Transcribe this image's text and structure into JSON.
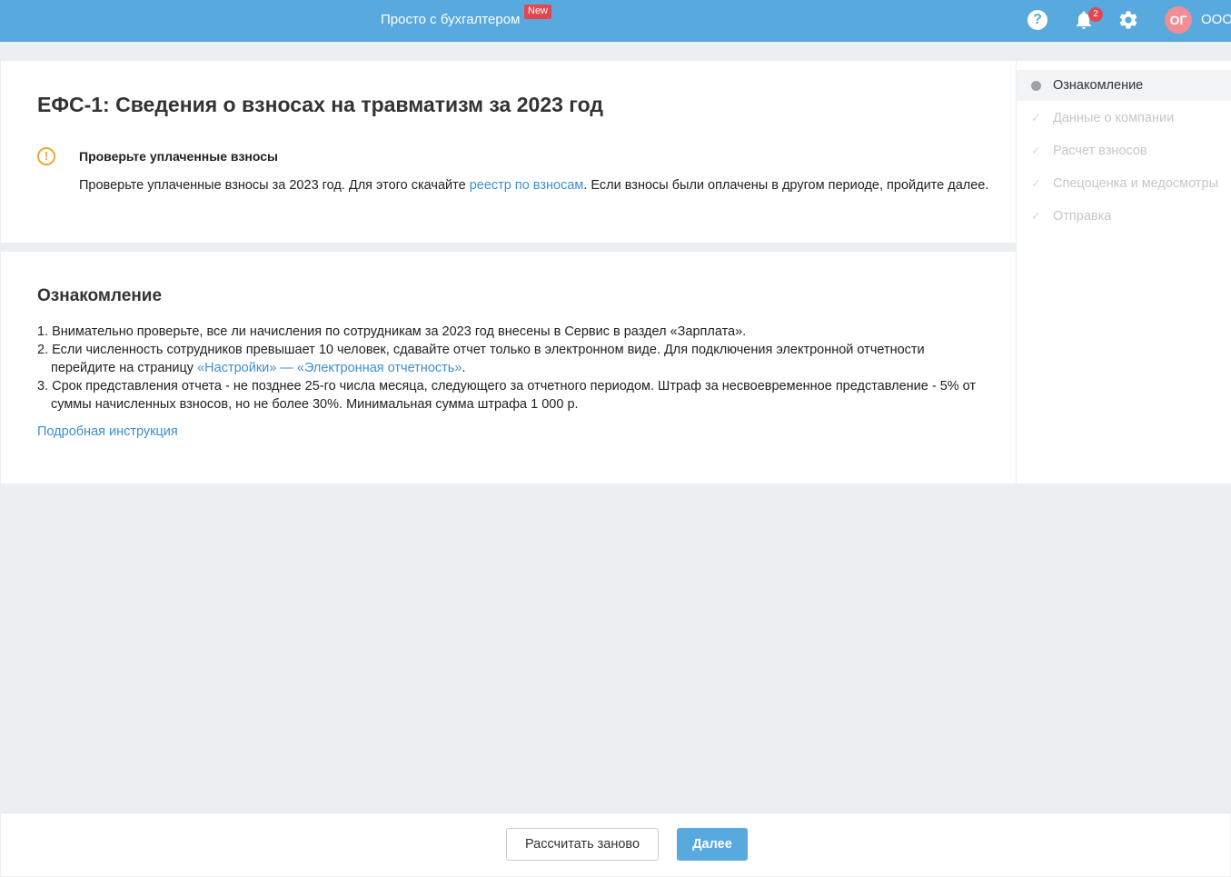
{
  "header": {
    "promo_label": "Просто с бухгалтером",
    "new_badge": "New",
    "help_icon": "?",
    "notification_count": "2",
    "avatar_initials": "ОГ",
    "org_name": "ООО"
  },
  "report": {
    "title": "ЕФС-1: Сведения о взносах на травматизм за 2023 год",
    "warning": {
      "icon": "!",
      "title": "Проверьте уплаченные взносы",
      "text_before": "Проверьте уплаченные взносы за 2023 год. Для этого скачайте ",
      "link": "реестр по взносам",
      "text_after": ". Если взносы были оплачены в другом периоде, пройдите далее."
    }
  },
  "intro": {
    "title": "Ознакомление",
    "items": [
      {
        "text": "1. Внимательно проверьте, все ли начисления по сотрудникам за 2023 год внесены в Сервис в раздел «Зарплата»."
      },
      {
        "text_before": "2. Если численность сотрудников превышает 10 человек, сдавайте отчет только в электронном виде. Для подключения электронной отчетности перейдите на страницу ",
        "link": "«Настройки» — «Электронная отчетность»",
        "text_after": "."
      },
      {
        "text": "3. Срок представления отчета - не позднее 25-го числа месяца, следующего за отчетного периодом. Штраф за несвоевременное представление - 5% от суммы начисленных взносов, но не более 30%. Минимальная сумма штрафа 1 000 р."
      }
    ],
    "more_link": "Подробная инструкция"
  },
  "steps": {
    "items": [
      {
        "label": "Ознакомление",
        "state": "active"
      },
      {
        "label": "Данные о компании",
        "state": "inactive"
      },
      {
        "label": "Расчет взносов",
        "state": "inactive"
      },
      {
        "label": "Спецоценка и медосмотры",
        "state": "inactive"
      },
      {
        "label": "Отправка",
        "state": "inactive"
      }
    ]
  },
  "footer": {
    "recalc_label": "Рассчитать заново",
    "next_label": "Далее"
  },
  "colors": {
    "header_bg": "#57a9de",
    "link": "#3d8fd1",
    "badge": "#e2474f",
    "warning": "#f0a734",
    "avatar": "#f08e94"
  }
}
